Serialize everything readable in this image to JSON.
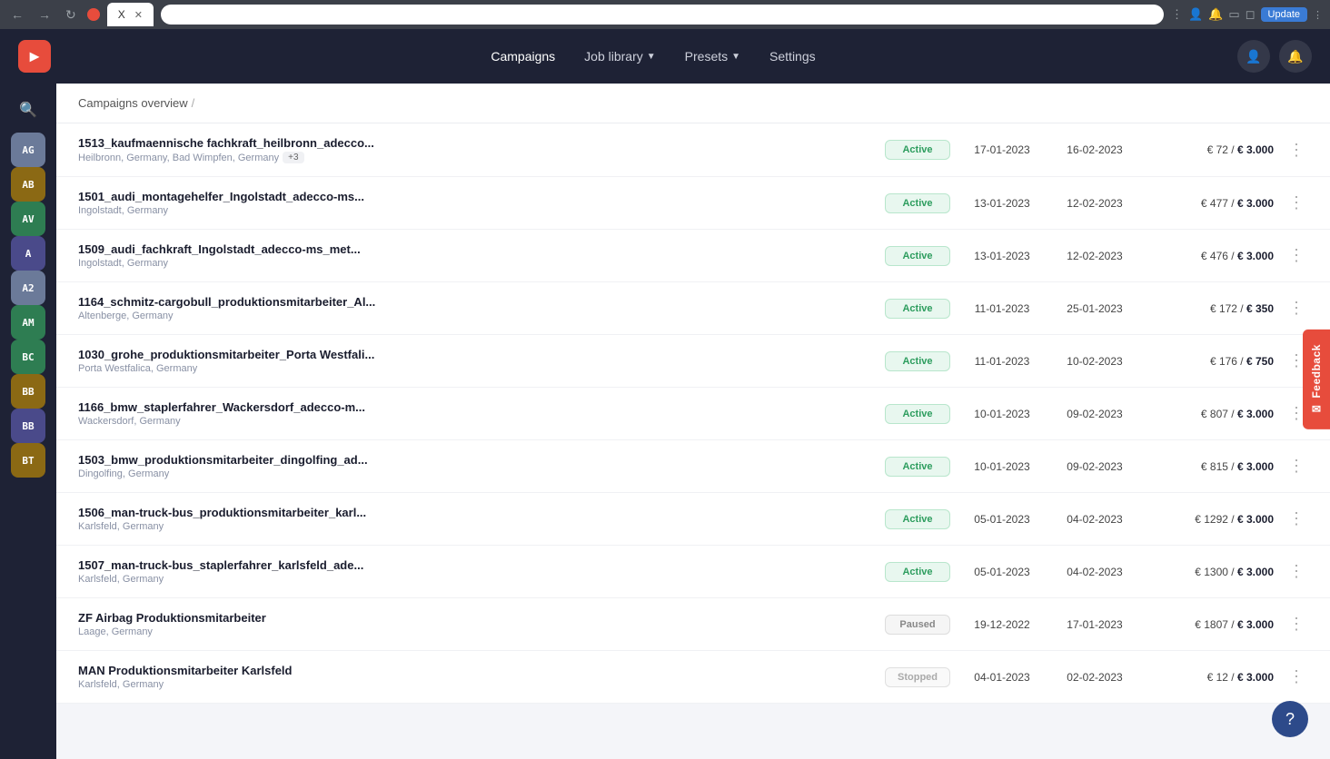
{
  "browser": {
    "tab_title": "X",
    "back_btn": "←",
    "forward_btn": "→",
    "refresh_btn": "↻",
    "update_btn": "Update"
  },
  "navbar": {
    "logo_text": "▶",
    "links": [
      {
        "label": "Campaigns",
        "active": true,
        "has_dropdown": false
      },
      {
        "label": "Job library",
        "active": false,
        "has_dropdown": true
      },
      {
        "label": "Presets",
        "active": false,
        "has_dropdown": true
      },
      {
        "label": "Settings",
        "active": false,
        "has_dropdown": false
      }
    ]
  },
  "breadcrumb": {
    "items": [
      "Campaigns overview",
      "/"
    ]
  },
  "sidebar": {
    "items": [
      {
        "label": "AG",
        "color": "#6b7a99"
      },
      {
        "label": "AB",
        "color": "#8b6914"
      },
      {
        "label": "AV",
        "color": "#2e7d52"
      },
      {
        "label": "A",
        "color": "#4a4a8a"
      },
      {
        "label": "A2",
        "color": "#6b7a99"
      },
      {
        "label": "AM",
        "color": "#2e7d52"
      },
      {
        "label": "BC",
        "color": "#2e7d52"
      },
      {
        "label": "BB",
        "color": "#8b6914"
      },
      {
        "label": "BB",
        "color": "#4a4a8a"
      },
      {
        "label": "BT",
        "color": "#8b6914"
      }
    ]
  },
  "campaigns": [
    {
      "name": "1513_kaufmaennische fachkraft_heilbronn_adecco...",
      "location": "Heilbronn, Germany, Bad Wimpfen, Germany",
      "extra_locations": "+3",
      "status": "Active",
      "status_type": "active",
      "start_date": "17-01-2023",
      "end_date": "16-02-2023",
      "spent": "€ 72",
      "budget": "€ 3.000"
    },
    {
      "name": "1501_audi_montagehelfer_Ingolstadt_adecco-ms...",
      "location": "Ingolstadt, Germany",
      "extra_locations": null,
      "status": "Active",
      "status_type": "active",
      "start_date": "13-01-2023",
      "end_date": "12-02-2023",
      "spent": "€ 477",
      "budget": "€ 3.000"
    },
    {
      "name": "1509_audi_fachkraft_Ingolstadt_adecco-ms_met...",
      "location": "Ingolstadt, Germany",
      "extra_locations": null,
      "status": "Active",
      "status_type": "active",
      "start_date": "13-01-2023",
      "end_date": "12-02-2023",
      "spent": "€ 476",
      "budget": "€ 3.000"
    },
    {
      "name": "1164_schmitz-cargobull_produktionsmitarbeiter_Al...",
      "location": "Altenberge, Germany",
      "extra_locations": null,
      "status": "Active",
      "status_type": "active",
      "start_date": "11-01-2023",
      "end_date": "25-01-2023",
      "spent": "€ 172",
      "budget": "€ 350"
    },
    {
      "name": "1030_grohe_produktionsmitarbeiter_Porta Westfali...",
      "location": "Porta Westfalica, Germany",
      "extra_locations": null,
      "status": "Active",
      "status_type": "active",
      "start_date": "11-01-2023",
      "end_date": "10-02-2023",
      "spent": "€ 176",
      "budget": "€ 750"
    },
    {
      "name": "1166_bmw_staplerfahrer_Wackersdorf_adecco-m...",
      "location": "Wackersdorf, Germany",
      "extra_locations": null,
      "status": "Active",
      "status_type": "active",
      "start_date": "10-01-2023",
      "end_date": "09-02-2023",
      "spent": "€ 807",
      "budget": "€ 3.000"
    },
    {
      "name": "1503_bmw_produktionsmitarbeiter_dingolfing_ad...",
      "location": "Dingolfing, Germany",
      "extra_locations": null,
      "status": "Active",
      "status_type": "active",
      "start_date": "10-01-2023",
      "end_date": "09-02-2023",
      "spent": "€ 815",
      "budget": "€ 3.000"
    },
    {
      "name": "1506_man-truck-bus_produktionsmitarbeiter_karl...",
      "location": "Karlsfeld, Germany",
      "extra_locations": null,
      "status": "Active",
      "status_type": "active",
      "start_date": "05-01-2023",
      "end_date": "04-02-2023",
      "spent": "€ 1292",
      "budget": "€ 3.000"
    },
    {
      "name": "1507_man-truck-bus_staplerfahrer_karlsfeld_ade...",
      "location": "Karlsfeld, Germany",
      "extra_locations": null,
      "status": "Active",
      "status_type": "active",
      "start_date": "05-01-2023",
      "end_date": "04-02-2023",
      "spent": "€ 1300",
      "budget": "€ 3.000"
    },
    {
      "name": "ZF Airbag Produktionsmitarbeiter",
      "location": "Laage, Germany",
      "extra_locations": null,
      "status": "Paused",
      "status_type": "paused",
      "start_date": "19-12-2022",
      "end_date": "17-01-2023",
      "spent": "€ 1807",
      "budget": "€ 3.000"
    },
    {
      "name": "MAN Produktionsmitarbeiter Karlsfeld",
      "location": "Karlsfeld, Germany",
      "extra_locations": null,
      "status": "Stopped",
      "status_type": "stopped",
      "start_date": "04-01-2023",
      "end_date": "02-02-2023",
      "spent": "€ 12",
      "budget": "€ 3.000"
    }
  ],
  "feedback": {
    "label": "Feedback"
  },
  "help": {
    "label": "?"
  }
}
